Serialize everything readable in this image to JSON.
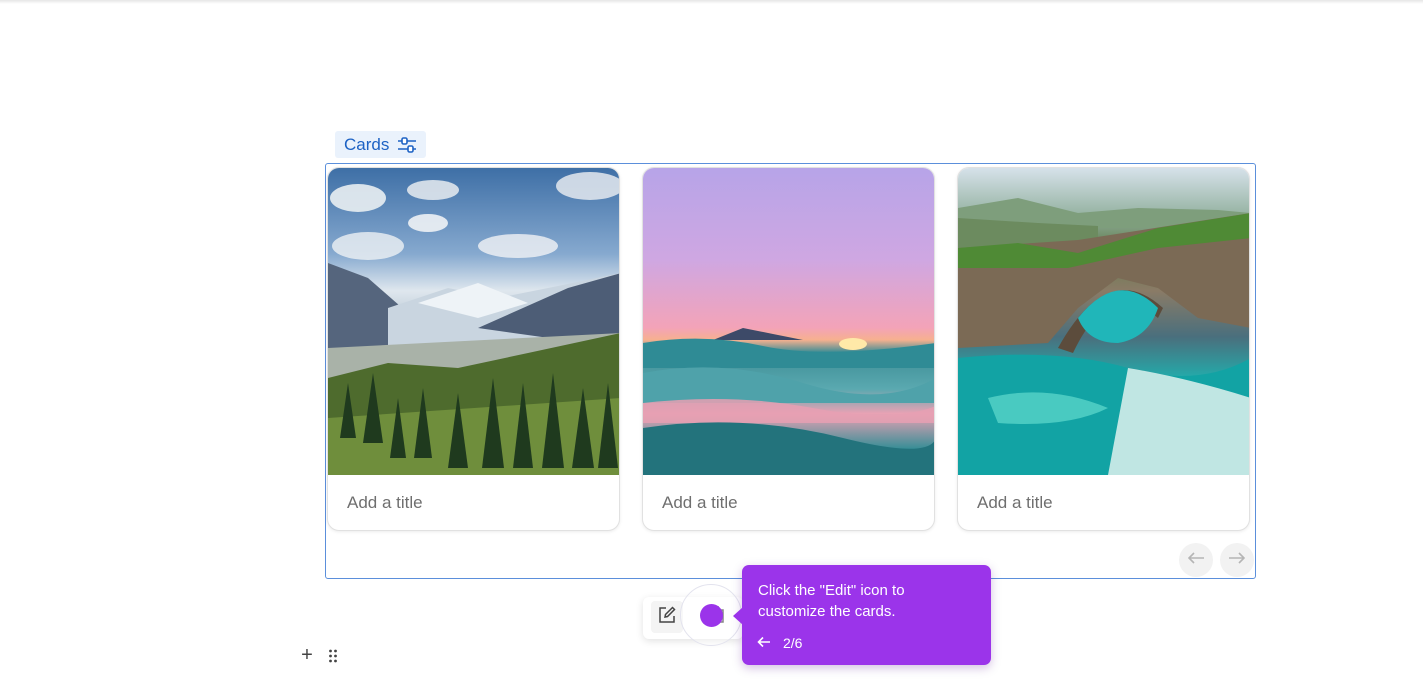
{
  "block": {
    "label": "Cards",
    "label_icon": "sliders-icon"
  },
  "cards": [
    {
      "title_placeholder": "Add a title",
      "image": "mountain-valley-forest"
    },
    {
      "title_placeholder": "Add a title",
      "image": "ocean-sunset-waves"
    },
    {
      "title_placeholder": "Add a title",
      "image": "sea-cliff-arch"
    }
  ],
  "navigation": {
    "prev_icon": "arrow-left-icon",
    "next_icon": "arrow-right-icon"
  },
  "toolbar": {
    "edit_icon": "edit-icon",
    "second_icon": "copy-icon"
  },
  "tooltip": {
    "text": "Click the \"Edit\" icon to customize the cards.",
    "step": "2/6",
    "back_icon": "arrow-left-icon"
  },
  "editor": {
    "add_label": "+",
    "drag_icon": "drag-handle-icon"
  },
  "colors": {
    "accent": "#1d62c4",
    "frame_border": "#5b8fdb",
    "tooltip_bg": "#9b34ea"
  }
}
